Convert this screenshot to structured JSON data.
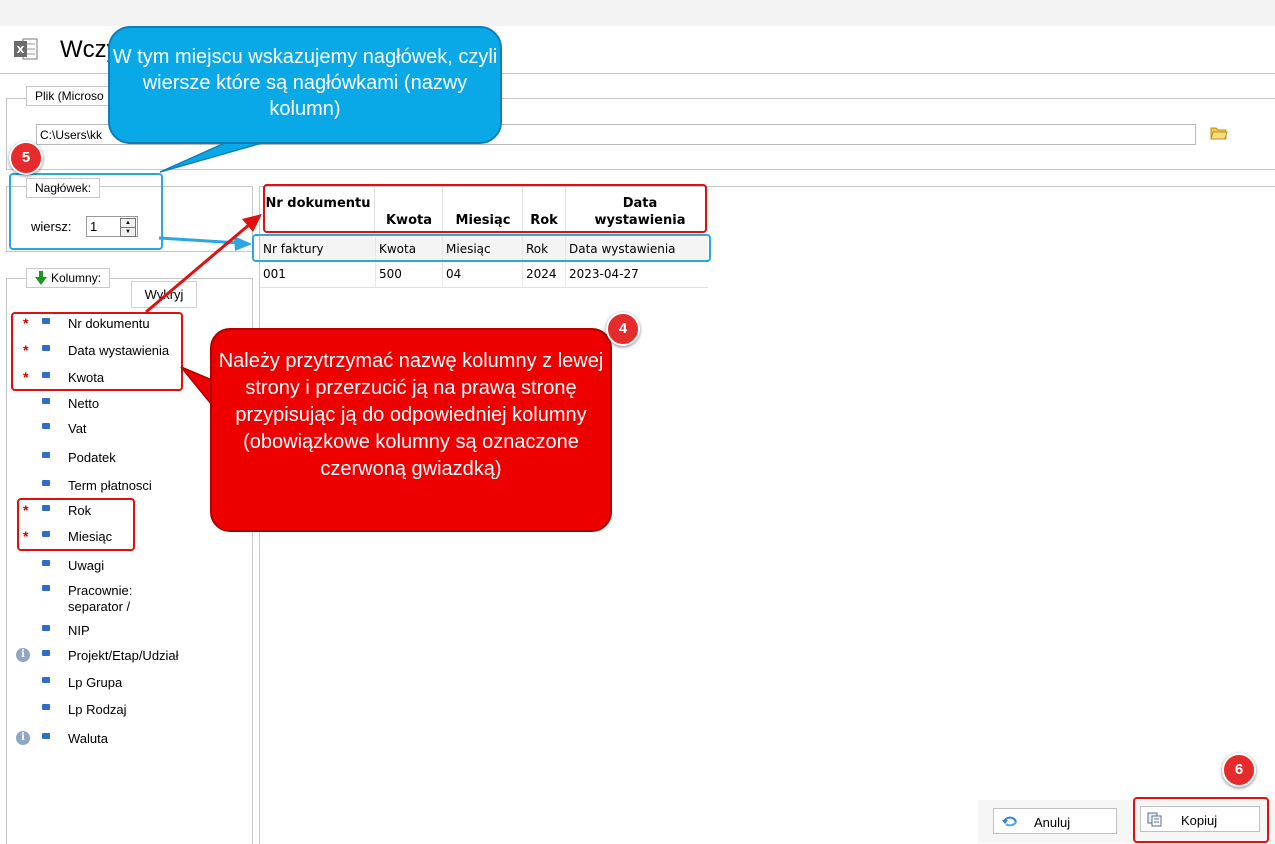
{
  "window": {
    "title": "Wczy"
  },
  "file_group": {
    "legend": "Plik (Microso",
    "path": "C:\\Users\\kk"
  },
  "header_group": {
    "legend": "Nagłówek:",
    "row_label": "wiersz:",
    "row_value": "1"
  },
  "columns_group": {
    "legend": "Kolumny:",
    "detect_button": "Wykryj",
    "items": [
      {
        "label": "Nr dokumentu",
        "required": true,
        "info": false
      },
      {
        "label": "Data wystawienia",
        "required": true,
        "info": false
      },
      {
        "label": "Kwota",
        "required": true,
        "info": false
      },
      {
        "label": "Netto",
        "required": false,
        "info": false
      },
      {
        "label": "Vat",
        "required": false,
        "info": false
      },
      {
        "label": "Podatek",
        "required": false,
        "info": false
      },
      {
        "label": "Term płatnosci",
        "required": false,
        "info": false
      },
      {
        "label": "Rok",
        "required": true,
        "info": false
      },
      {
        "label": "Miesiąc",
        "required": true,
        "info": false
      },
      {
        "label": "Uwagi",
        "required": false,
        "info": false
      },
      {
        "label": "Pracownie: separator /",
        "required": false,
        "info": false
      },
      {
        "label": "NIP",
        "required": false,
        "info": false
      },
      {
        "label": "Projekt/Etap/Udział",
        "required": false,
        "info": true
      },
      {
        "label": "Lp Grupa",
        "required": false,
        "info": false
      },
      {
        "label": "Lp Rodzaj",
        "required": false,
        "info": false
      },
      {
        "label": "Waluta",
        "required": false,
        "info": true
      }
    ]
  },
  "grid": {
    "mapped_headers": [
      "Nr dokumentu",
      "Kwota",
      "Miesiąc",
      "Rok",
      "Data wystawienia"
    ],
    "file_headers": [
      "Nr faktury",
      "Kwota",
      "Miesiąc",
      "Rok",
      "Data wystawienia"
    ],
    "rows": [
      [
        "001",
        "500",
        "04",
        "2024",
        "2023-04-27"
      ]
    ]
  },
  "callouts": {
    "blue": "W tym miejscu wskazujemy nagłówek, czyli wiersze które są nagłówkami (nazwy kolumn)",
    "red": "Należy przytrzymać nazwę kolumny z lewej strony i przerzucić ją na prawą stronę przypisując ją do odpowiedniej kolumny (obowiązkowe kolumny są oznaczone czerwoną gwiazdką)"
  },
  "badges": {
    "b5": "5",
    "b4": "4",
    "b6": "6"
  },
  "buttons": {
    "cancel": "Anuluj",
    "copy": "Kopiuj"
  },
  "colors": {
    "callout_blue": "#08a9e6",
    "callout_red": "#ee0000",
    "highlight_red": "#e01010",
    "highlight_blue": "#2aa7e0"
  }
}
